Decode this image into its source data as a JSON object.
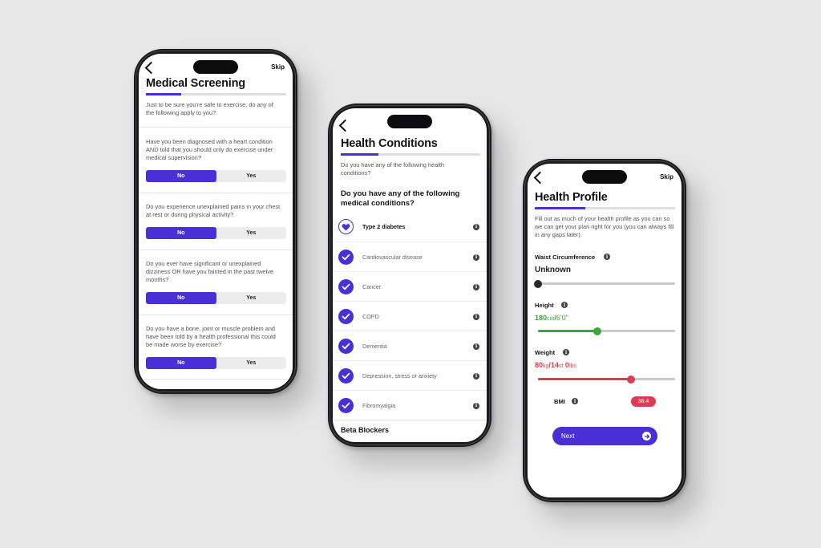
{
  "colors": {
    "accent": "#4a2fd6",
    "green": "#3aa83a",
    "red": "#e03a52"
  },
  "screening": {
    "skip": "Skip",
    "title": "Medical Screening",
    "progress": 0.25,
    "intro": "Just to be sure you're safe to exercise, do any of the following apply to you?",
    "questions": [
      {
        "text": "Have you been diagnosed with a heart condition AND told that you should only do exercise under medical supervision?",
        "no": "No",
        "yes": "Yes",
        "selected": "No"
      },
      {
        "text": "Do you experience unexplained pains in your chest at rest or during physical activity?",
        "no": "No",
        "yes": "Yes",
        "selected": "No"
      },
      {
        "text": "Do you ever have significant or unexplained dizziness OR have you fainted in the past twelve months?",
        "no": "No",
        "yes": "Yes",
        "selected": "No"
      },
      {
        "text": "Do you have a bone, joint or muscle problem and have been told by a health professional this could be made worse by exercise?",
        "no": "No",
        "yes": "Yes",
        "selected": "No"
      }
    ]
  },
  "conditions": {
    "title": "Health Conditions",
    "progress": 0.27,
    "intro": "Do you have any of the following health conditions?",
    "question": "Do you have any of the following medical conditions?",
    "items": [
      {
        "label": "Type 2 diabetes",
        "icon": "heart-icon"
      },
      {
        "label": "Cardiovascular disease",
        "icon": "check-icon"
      },
      {
        "label": "Cancer",
        "icon": "check-icon"
      },
      {
        "label": "COPD",
        "icon": "check-icon"
      },
      {
        "label": "Dementia",
        "icon": "check-icon"
      },
      {
        "label": "Depression, stress or anxiety",
        "icon": "check-icon"
      },
      {
        "label": "Fibromyalgia",
        "icon": "check-icon"
      }
    ],
    "section": "Beta Blockers"
  },
  "profile": {
    "skip": "Skip",
    "title": "Health Profile",
    "progress": 0.36,
    "intro": "Fill out as much of your health profile as you can so we can get your plan right for you (you can always fill in any gaps later).",
    "waist": {
      "label": "Waist Circumference",
      "value": "Unknown",
      "level": 0.0
    },
    "height": {
      "label": "Height",
      "cm": "180",
      "cm_unit": "cm",
      "ft": "6'0\"",
      "level": 0.43
    },
    "weight": {
      "label": "Weight",
      "kg": "80",
      "kg_unit": "kg",
      "st": "14",
      "st_unit": "st",
      "lbs": "0",
      "lbs_unit": "lbs",
      "level": 0.68
    },
    "bmi": {
      "label": "BMI",
      "value": "38.4"
    },
    "next": "Next"
  }
}
